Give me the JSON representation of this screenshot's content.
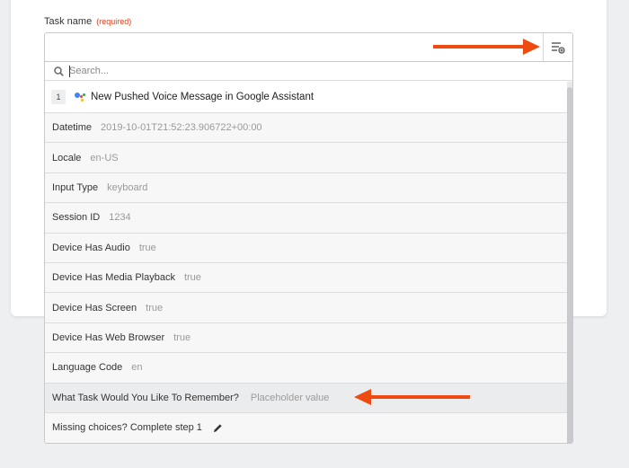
{
  "form": {
    "label": "Task name",
    "required": "(required)"
  },
  "search": {
    "placeholder": "Search..."
  },
  "step": {
    "number": "1",
    "title": "New Pushed Voice Message in Google Assistant"
  },
  "fields": [
    {
      "key": "Datetime",
      "value": "2019-10-01T21:52:23.906722+00:00"
    },
    {
      "key": "Locale",
      "value": "en-US"
    },
    {
      "key": "Input Type",
      "value": "keyboard"
    },
    {
      "key": "Session ID",
      "value": "1234"
    },
    {
      "key": "Device Has Audio",
      "value": "true"
    },
    {
      "key": "Device Has Media Playback",
      "value": "true"
    },
    {
      "key": "Device Has Screen",
      "value": "true"
    },
    {
      "key": "Device Has Web Browser",
      "value": "true"
    },
    {
      "key": "Language Code",
      "value": "en"
    },
    {
      "key": "What Task Would You Like To Remember?",
      "value": "Placeholder value"
    }
  ],
  "footer": {
    "missing": "Missing choices? Complete step 1"
  },
  "colors": {
    "arrow": "#ee4b12",
    "required": "#e0401d",
    "google_blue": "#4285f4",
    "google_red": "#ea4335",
    "google_yellow": "#fbbc05",
    "google_green": "#34a853"
  },
  "icons": {
    "insert_field": "insert-field-icon",
    "search": "search-icon",
    "app": "google-assistant-icon",
    "edit": "pencil-icon"
  }
}
